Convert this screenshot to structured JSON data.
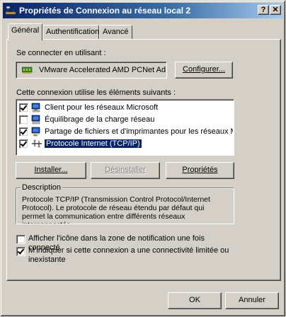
{
  "window": {
    "title": "Propriétés de Connexion au réseau local 2",
    "help_button": "?",
    "close_button": "✕"
  },
  "tabs": [
    {
      "label": "Général",
      "active": true
    },
    {
      "label": "Authentification",
      "active": false
    },
    {
      "label": "Avancé",
      "active": false
    }
  ],
  "connect_using": {
    "label": "Se connecter en utilisant :",
    "adapter": "VMware Accelerated AMD PCNet Ad",
    "configure_button": "Configurer..."
  },
  "components": {
    "label": "Cette connexion utilise les éléments suivants :",
    "items": [
      {
        "label": "Client pour les réseaux Microsoft",
        "checked": true,
        "icon": "network-client-icon"
      },
      {
        "label": "Équilibrage de la charge réseau",
        "checked": false,
        "icon": "load-balancing-icon"
      },
      {
        "label": "Partage de fichiers et d'imprimantes pour les réseaux Mi...",
        "checked": true,
        "icon": "file-printer-sharing-icon"
      },
      {
        "label": "Protocole Internet (TCP/IP)",
        "checked": true,
        "icon": "protocol-icon",
        "selected": true
      }
    ]
  },
  "buttons": {
    "install": "Installer...",
    "uninstall": "Désinstaller",
    "properties": "Propriétés"
  },
  "description": {
    "title": "Description",
    "text": "Protocole TCP/IP (Transmission Control Protocol/Internet Protocol). Le protocole de réseau étendu par défaut qui permet la communication entre différents réseaux interconnectés."
  },
  "options": [
    {
      "label": "Afficher l'icône dans la zone de notification une fois connecté",
      "checked": false
    },
    {
      "label": "M'indiquer si cette connexion a une connectivité limitée ou inexistante",
      "checked": true
    }
  ],
  "footer": {
    "ok": "OK",
    "cancel": "Annuler"
  },
  "colors": {
    "titlebar_start": "#0a246a",
    "titlebar_end": "#a6caf0",
    "face": "#d4d0c8",
    "selection": "#0a246a"
  }
}
